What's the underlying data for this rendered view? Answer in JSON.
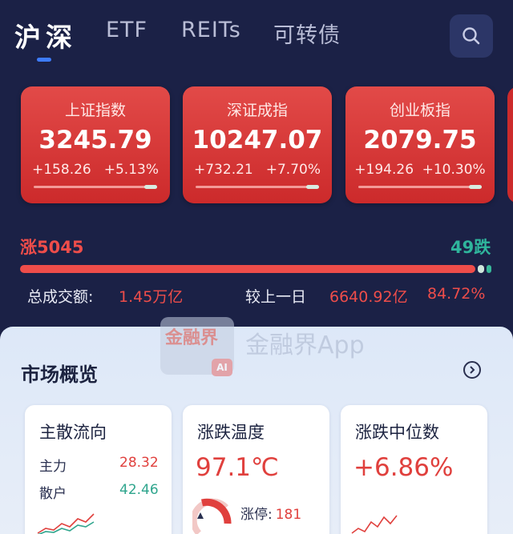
{
  "tabs": [
    {
      "label": "沪深",
      "active": true
    },
    {
      "label": "ETF",
      "active": false
    },
    {
      "label": "REITs",
      "active": false
    },
    {
      "label": "可转债",
      "active": false
    }
  ],
  "search_icon": "search-icon",
  "indices": [
    {
      "name": "上证指数",
      "value": "3245.79",
      "change": "+158.26",
      "pct": "+5.13%"
    },
    {
      "name": "深证成指",
      "value": "10247.07",
      "change": "+732.21",
      "pct": "+7.70%"
    },
    {
      "name": "创业板指",
      "value": "2079.75",
      "change": "+194.26",
      "pct": "+10.30%"
    }
  ],
  "breadth": {
    "up_label": "涨5045",
    "down_label": "49跌"
  },
  "turnover": {
    "label": "总成交额:",
    "value": "1.45万亿",
    "compare_label": "较上一日",
    "compare_value": "6640.92亿",
    "compare_pct": "84.72%"
  },
  "overview": {
    "title": "市场概览",
    "watermark_logo": "金融界",
    "watermark_text": "金融界App",
    "watermark_badge": "AI",
    "cards": {
      "flow": {
        "title": "主散流向",
        "main_label": "主力",
        "main_value": "28.32",
        "retail_label": "散户",
        "retail_value": "42.46"
      },
      "temp": {
        "title": "涨跌温度",
        "value": "97.1℃",
        "limit_label": "涨停:",
        "limit_value": "181"
      },
      "median": {
        "title": "涨跌中位数",
        "value": "+6.86%"
      }
    }
  },
  "colors": {
    "bg": "#1b2146",
    "up": "#ee4d4a",
    "down": "#2fb59c",
    "accent": "#3d7cff"
  }
}
